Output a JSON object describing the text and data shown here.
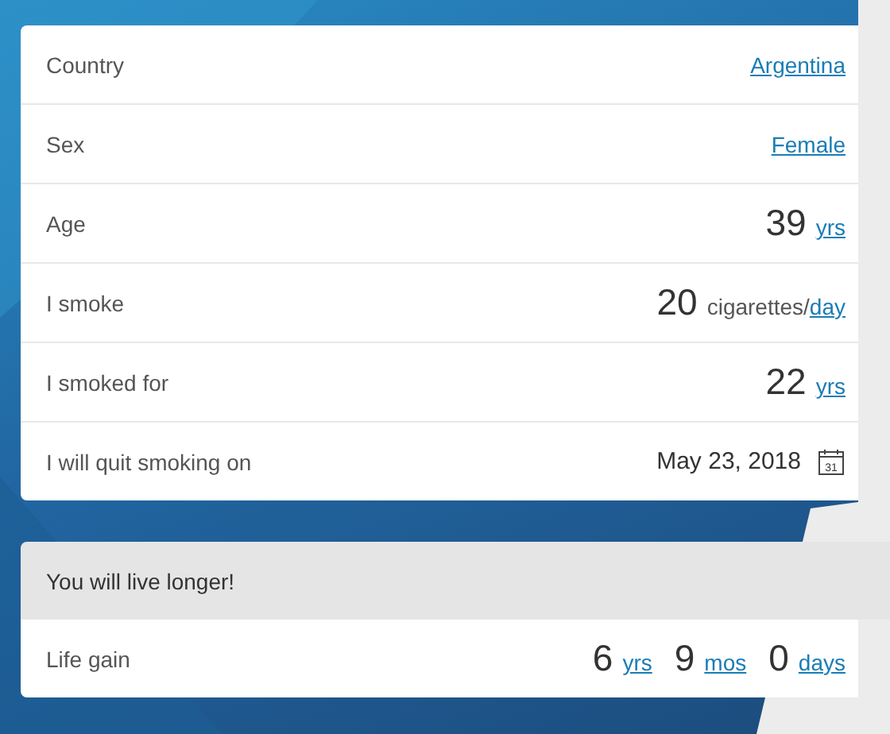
{
  "inputs": [
    {
      "label": "Country",
      "kind": "link",
      "value": "Argentina"
    },
    {
      "label": "Sex",
      "kind": "link",
      "value": "Female"
    },
    {
      "label": "Age",
      "kind": "quantity",
      "number": "39",
      "unit": "yrs"
    },
    {
      "label": "I smoke",
      "kind": "rate",
      "number": "20",
      "unit_text": "cigarettes/",
      "unit": "day"
    },
    {
      "label": "I smoked for",
      "kind": "quantity",
      "number": "22",
      "unit": "yrs"
    },
    {
      "label": "I will quit smoking on",
      "kind": "date",
      "value": "May 23, 2018",
      "icon_text": "31"
    }
  ],
  "result": {
    "title": "You will live longer!",
    "label": "Life gain",
    "parts": [
      {
        "number": "6",
        "unit": "yrs"
      },
      {
        "number": "9",
        "unit": "mos"
      },
      {
        "number": "0",
        "unit": "days"
      }
    ]
  }
}
